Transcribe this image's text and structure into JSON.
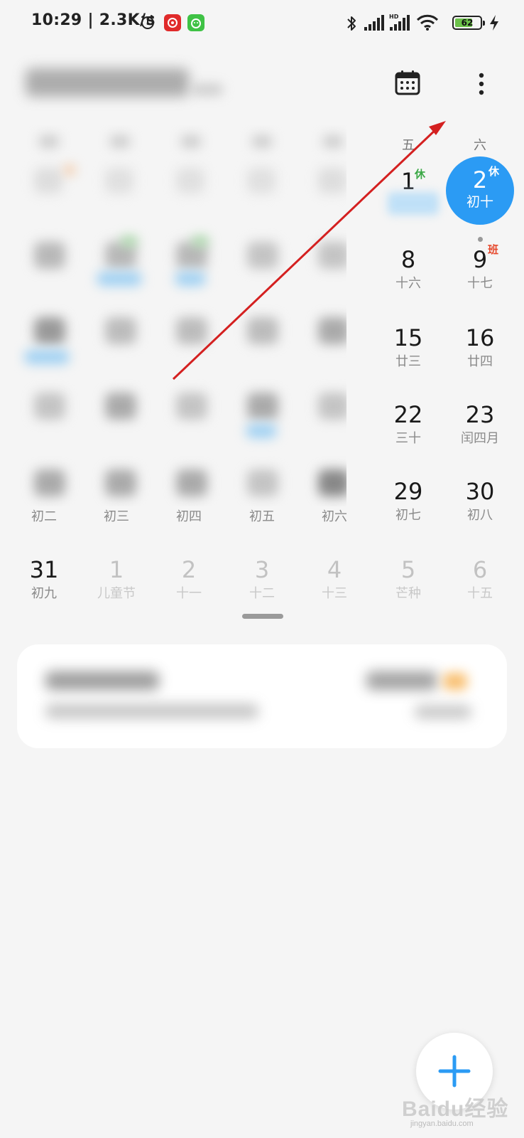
{
  "status_bar": {
    "time": "10:29 | 2.3K/s",
    "battery": "62"
  },
  "calendar": {
    "weekdays": {
      "fri": "五",
      "sat": "六"
    },
    "today": {
      "day": "2",
      "lunar": "初十",
      "badge": "休"
    },
    "right_cells": {
      "fri_1": {
        "day": "1",
        "badge": "休"
      },
      "fri_8": {
        "day": "8",
        "lunar": "十六"
      },
      "sat_9": {
        "day": "9",
        "lunar": "十七",
        "badge": "班"
      },
      "fri_15": {
        "day": "15",
        "lunar": "廿三"
      },
      "sat_16": {
        "day": "16",
        "lunar": "廿四"
      },
      "fri_22": {
        "day": "22",
        "lunar": "三十"
      },
      "sat_23": {
        "day": "23",
        "lunar": "闰四月"
      },
      "fri_29": {
        "day": "29",
        "lunar": "初七"
      },
      "sat_30": {
        "day": "30",
        "lunar": "初八"
      }
    },
    "row5_lunar": [
      "初二",
      "初三",
      "初四",
      "初五",
      "初六"
    ],
    "last_row": [
      {
        "day": "31",
        "lunar": "初九"
      },
      {
        "day": "1",
        "lunar": "儿童节"
      },
      {
        "day": "2",
        "lunar": "十一"
      },
      {
        "day": "3",
        "lunar": "十二"
      },
      {
        "day": "4",
        "lunar": "十三"
      },
      {
        "day": "5",
        "lunar": "芒种"
      },
      {
        "day": "6",
        "lunar": "十五"
      }
    ]
  },
  "icons": {
    "calendar": "calendar-icon",
    "more": "more-vertical-icon",
    "add": "plus-icon"
  },
  "colors": {
    "accent": "#2b9bf4",
    "rest": "#3aa845",
    "work": "#e6492d",
    "arrow": "#d42020"
  },
  "watermark": {
    "text": "Baidu经验",
    "sub": "jingyan.baidu.com"
  }
}
